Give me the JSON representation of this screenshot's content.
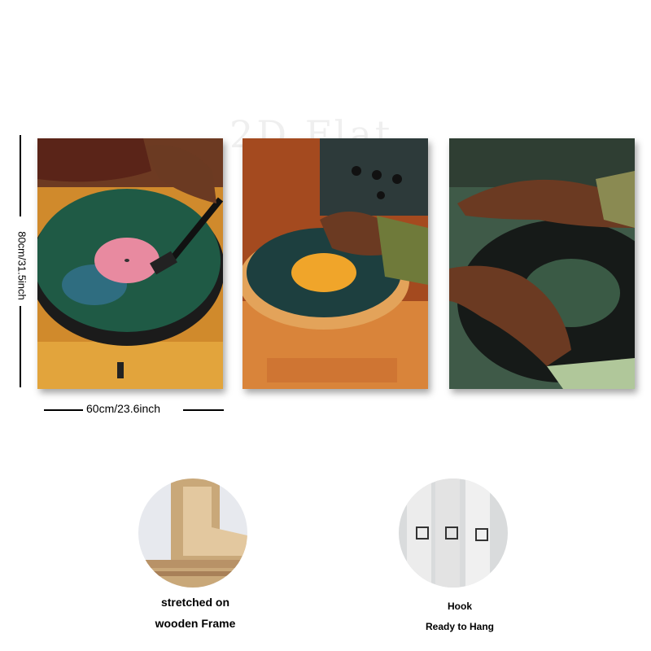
{
  "watermark": "2D Flat",
  "dimensions": {
    "height_label": "80cm/31.5inch",
    "width_label": "60cm/23.6inch"
  },
  "panels": [
    {
      "name": "panel-left",
      "depicts": "turntable with green vinyl and tonearm"
    },
    {
      "name": "panel-center",
      "depicts": "hand on spinning vinyl record"
    },
    {
      "name": "panel-right",
      "depicts": "two hands scratching a vinyl record"
    }
  ],
  "features": {
    "frame": {
      "line1": "stretched on",
      "line2": "wooden Frame"
    },
    "hook": {
      "line1": "Hook",
      "line2": "Ready to Hang"
    }
  },
  "colors": {
    "vinyl_green": "#1f5a45",
    "wood_orange": "#d98a2a",
    "skin_brown": "#6b3a22"
  }
}
